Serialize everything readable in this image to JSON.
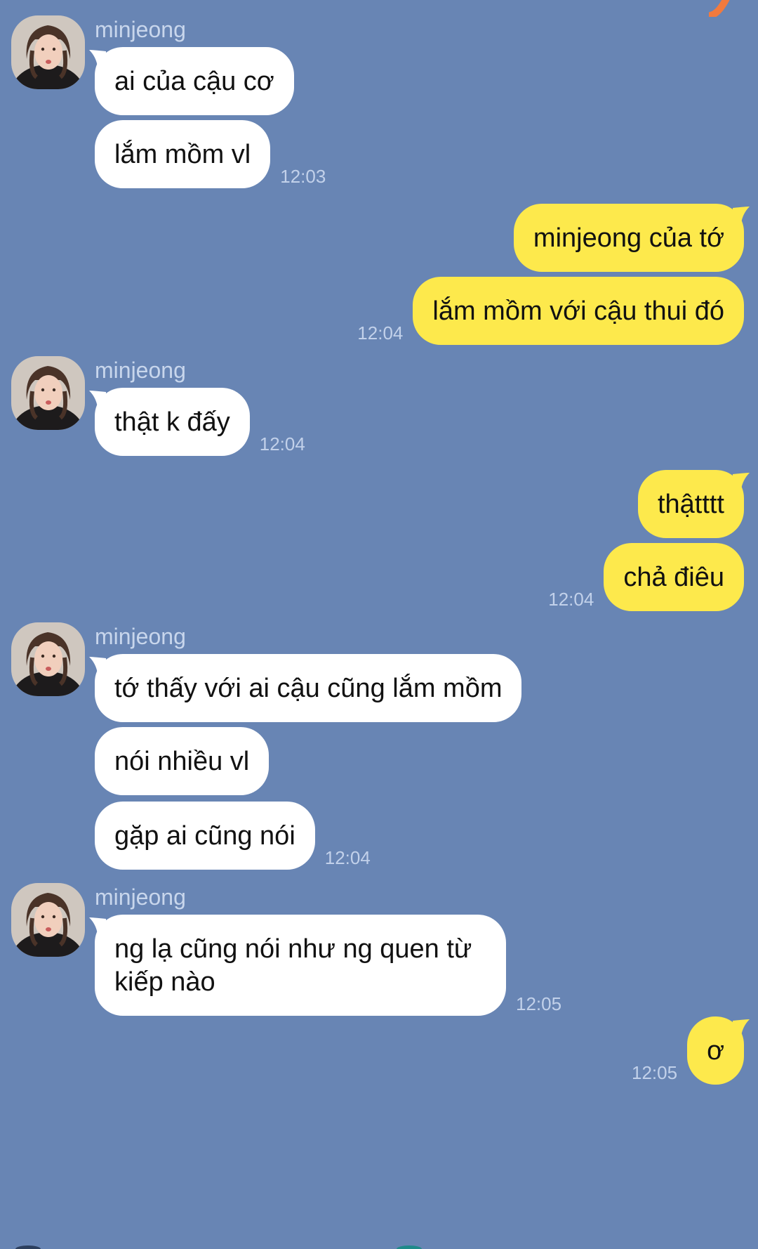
{
  "colors": {
    "background": "#6885b4",
    "incoming_bubble": "#ffffff",
    "outgoing_bubble": "#fde94c",
    "sender_name": "#c8d6ec",
    "timestamp": "#c2d1ea"
  },
  "groups": [
    {
      "sender": "minjeong",
      "direction": "incoming",
      "messages": [
        "ai của cậu cơ",
        "lắm mồm vl"
      ],
      "time": "12:03"
    },
    {
      "direction": "outgoing",
      "messages": [
        "minjeong của tớ",
        "lắm mồm với cậu thui đó"
      ],
      "time": "12:04"
    },
    {
      "sender": "minjeong",
      "direction": "incoming",
      "messages": [
        "thật k đấy"
      ],
      "time": "12:04"
    },
    {
      "direction": "outgoing",
      "messages": [
        "thậtttt",
        "chả điêu"
      ],
      "time": "12:04"
    },
    {
      "sender": "minjeong",
      "direction": "incoming",
      "messages": [
        "tớ thấy với ai cậu cũng lắm mồm",
        "nói nhiều vl",
        "gặp ai cũng nói"
      ],
      "time": "12:04"
    },
    {
      "sender": "minjeong",
      "direction": "incoming",
      "messages": [
        "ng lạ cũng nói như ng quen từ kiếp nào"
      ],
      "time": "12:05"
    },
    {
      "direction": "outgoing",
      "messages": [
        "ơ"
      ],
      "time": "12:05"
    }
  ],
  "icons": {
    "avatar": "profile-photo",
    "corner": "orange-corner-mark"
  }
}
